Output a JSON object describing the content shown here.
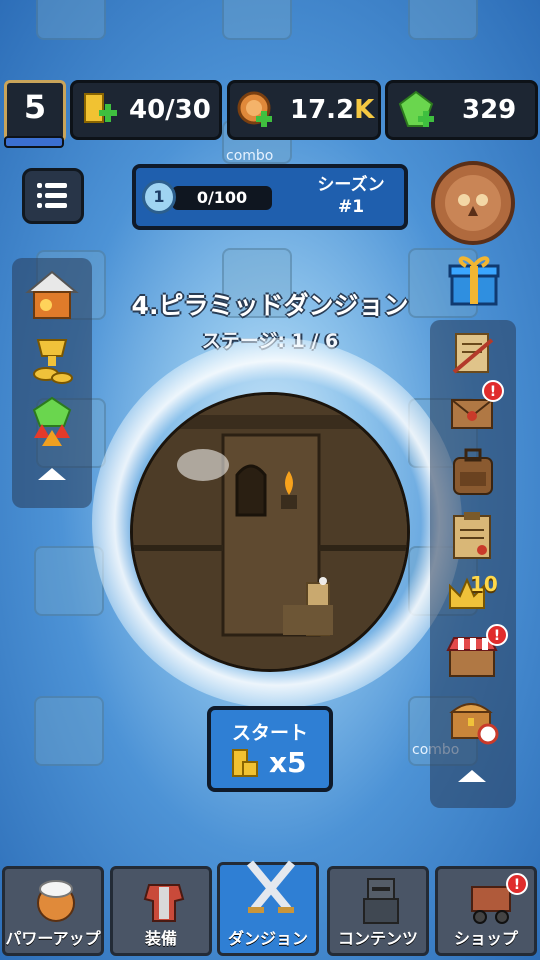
{
  "player": {
    "level": "5"
  },
  "stats": {
    "energy": "40/30",
    "coins_main": "17.2",
    "coins_suffix": "K",
    "gems": "329"
  },
  "season": {
    "badge_level": "1",
    "progress": "0/100",
    "title": "シーズン",
    "number": "#1"
  },
  "dungeon": {
    "title": "4.ピラミッドダンジョン",
    "stage": "ステージ: 1 / 6"
  },
  "start": {
    "label": "スタート",
    "cost": "x5"
  },
  "background_tiles": {
    "combo_top": "combo",
    "combo_bottom": "combo"
  },
  "right_panel": {
    "level_badge": "10"
  },
  "nav": {
    "tabs": [
      {
        "label": "パワーアップ",
        "icon": "chef-icon"
      },
      {
        "label": "装備",
        "icon": "armor-icon"
      },
      {
        "label": "ダンジョン",
        "icon": "crossed-swords-icon"
      },
      {
        "label": "コンテンツ",
        "icon": "knight-icon"
      },
      {
        "label": "ショップ",
        "icon": "cart-icon"
      }
    ],
    "active": "ダンジョン"
  },
  "colors": {
    "accent": "#2f7fd4",
    "panel_dark": "#1d2633",
    "alert": "#e02c2c",
    "coin_suffix": "#f5c842"
  }
}
